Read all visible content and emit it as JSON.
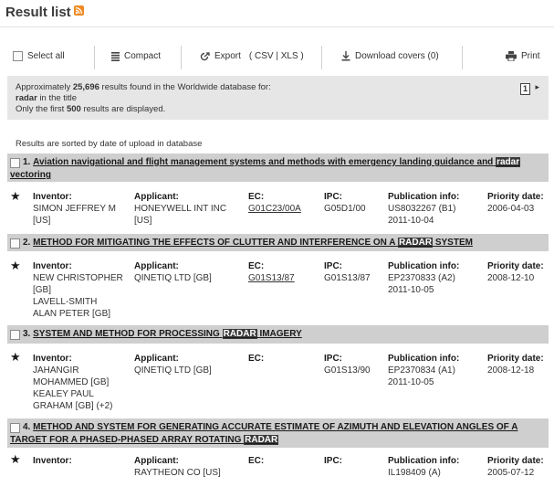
{
  "page": {
    "title": "Result list"
  },
  "toolbar": {
    "select_all": "Select all",
    "compact": "Compact",
    "export": "Export",
    "export_formats": "( CSV | XLS )",
    "download_covers": "Download covers (0)",
    "print": "Print"
  },
  "summary": {
    "approx": "Approximately",
    "count": "25,696",
    "found_text": "results found in the Worldwide database for:",
    "query": "radar",
    "scope": "in the title",
    "only_first": "Only the first",
    "limit": "500",
    "displayed": "results are displayed.",
    "page_number": "1"
  },
  "sort_note": "Results are sorted by date of upload in database",
  "labels": {
    "inventor": "Inventor:",
    "applicant": "Applicant:",
    "ec": "EC:",
    "ipc": "IPC:",
    "publication": "Publication info:",
    "priority": "Priority date:"
  },
  "results": [
    {
      "index": "1.",
      "title_pre": "Aviation navigational and flight management systems and methods with emergency landing guidance and",
      "title_hl": "radar",
      "title_post": "vectoring",
      "inventor": [
        "SIMON JEFFREY M",
        "[US]"
      ],
      "applicant": [
        "HONEYWELL INT INC",
        "[US]"
      ],
      "ec": "G01C23/00A",
      "ipc": "G05D1/00",
      "publication": [
        "US8032267 (B1)",
        "2011-10-04"
      ],
      "priority": "2006-04-03"
    },
    {
      "index": "2.",
      "title_pre": "METHOD FOR MITIGATING THE EFFECTS OF CLUTTER AND INTERFERENCE ON A",
      "title_hl": "RADAR",
      "title_post": "SYSTEM",
      "inventor": [
        "NEW CHRISTOPHER",
        "[GB]",
        "LAVELL-SMITH",
        "ALAN PETER [GB]"
      ],
      "applicant": [
        "QINETIQ LTD [GB]"
      ],
      "ec": "G01S13/87",
      "ipc": "G01S13/87",
      "publication": [
        "EP2370833 (A2)",
        "2011-10-05"
      ],
      "priority": "2008-12-10"
    },
    {
      "index": "3.",
      "title_pre": "SYSTEM AND METHOD FOR PROCESSING",
      "title_hl": "RADAR",
      "title_post": "IMAGERY",
      "inventor": [
        "JAHANGIR",
        "MOHAMMED [GB]",
        "KEALEY PAUL",
        "GRAHAM [GB] (+2)"
      ],
      "applicant": [
        "QINETIQ LTD [GB]"
      ],
      "ec": "",
      "ipc": "G01S13/90",
      "publication": [
        "EP2370834 (A1)",
        "2011-10-05"
      ],
      "priority": "2008-12-18"
    },
    {
      "index": "4.",
      "title_pre": "METHOD AND SYSTEM FOR GENERATING ACCURATE ESTIMATE OF AZIMUTH AND ELEVATION ANGLES OF A TARGET FOR A PHASED-PHASED ARRAY ROTATING",
      "title_hl": "RADAR",
      "title_post": "",
      "inventor": [],
      "applicant": [
        "RAYTHEON CO [US]"
      ],
      "ec": "",
      "ipc": "",
      "publication": [
        "IL198409 (A)"
      ],
      "priority": "2005-07-12"
    }
  ]
}
